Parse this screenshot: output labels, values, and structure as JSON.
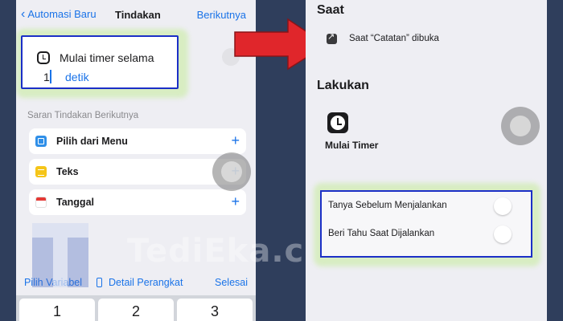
{
  "left_screen": {
    "nav": {
      "back_label": "Automasi Baru",
      "title": "Tindakan",
      "next_label": "Berikutnya"
    },
    "action": {
      "icon": "clock-icon",
      "title": "Mulai timer selama",
      "value": "1",
      "unit": "detik"
    },
    "suggestions": {
      "heading": "Saran Tindakan Berikutnya",
      "items": [
        {
          "label": "Pilih dari Menu",
          "icon": "menu-icon"
        },
        {
          "label": "Teks",
          "icon": "text-icon"
        },
        {
          "label": "Tanggal",
          "icon": "calendar-icon"
        }
      ]
    },
    "keyboard_bar": {
      "variable_label": "Pilih Variabel",
      "device_label": "Detail Perangkat",
      "done_label": "Selesai"
    },
    "keypad": [
      "1",
      "2",
      "3"
    ]
  },
  "watermark": {
    "text": "TediEka.com"
  },
  "right_screen": {
    "when_heading": "Saat",
    "trigger_text": "Saat “Catatan” dibuka",
    "do_heading": "Lakukan",
    "action_label": "Mulai Timer",
    "options": [
      {
        "label": "Tanya Sebelum Menjalankan",
        "enabled": false
      },
      {
        "label": "Beri Tahu Saat Dijalankan",
        "enabled": false
      }
    ]
  },
  "colors": {
    "accent_blue": "#1a73e8",
    "highlight_border": "#1b2fc7",
    "arrow_red": "#e0262b",
    "background": "#2f3e5c"
  }
}
